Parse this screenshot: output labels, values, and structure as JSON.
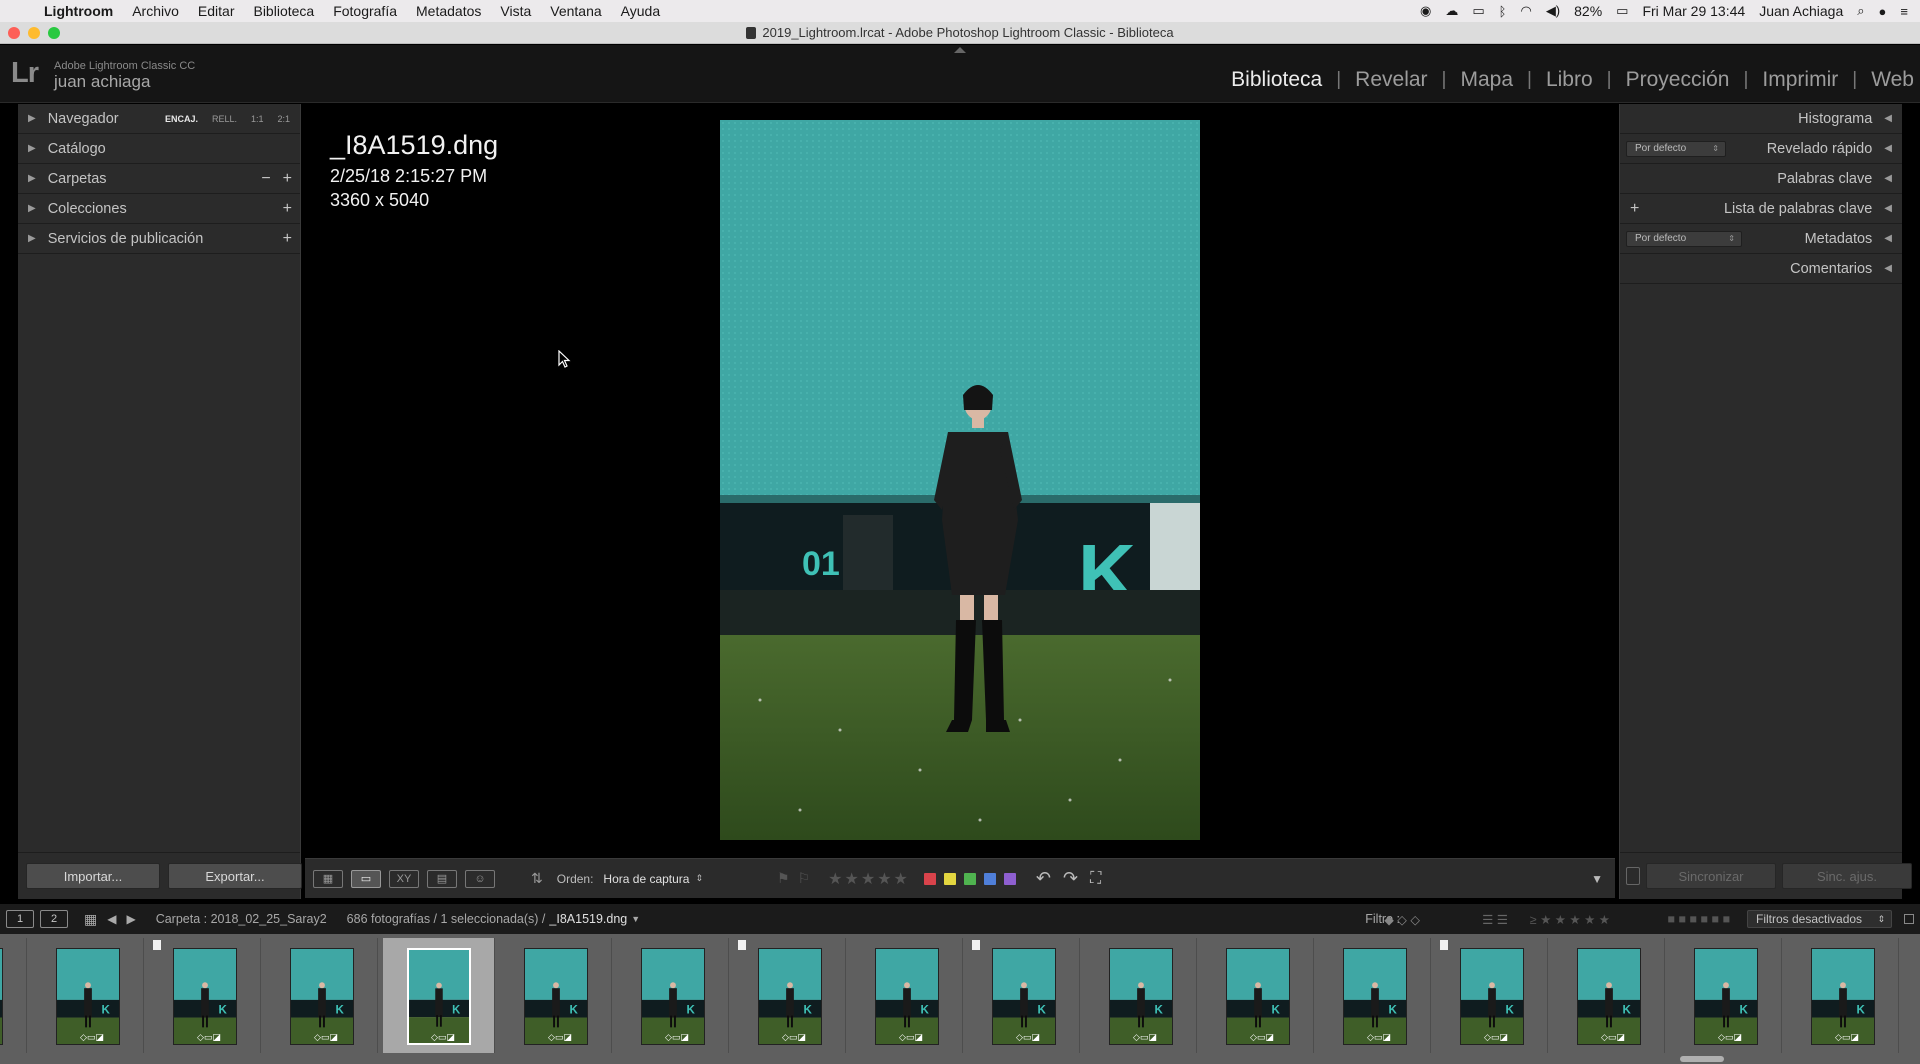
{
  "menubar": {
    "items": [
      "Lightroom",
      "Archivo",
      "Editar",
      "Biblioteca",
      "Fotografía",
      "Metadatos",
      "Vista",
      "Ventana",
      "Ayuda"
    ],
    "battery": "82%",
    "datetime": "Fri Mar 29  13:44",
    "user": "Juan Achiaga"
  },
  "window": {
    "title": "2019_Lightroom.lrcat - Adobe Photoshop Lightroom Classic - Biblioteca"
  },
  "identity": {
    "logo": "Lr",
    "product": "Adobe Lightroom Classic CC",
    "user": "juan achiaga"
  },
  "modules": [
    "Biblioteca",
    "Revelar",
    "Mapa",
    "Libro",
    "Proyección",
    "Imprimir",
    "Web"
  ],
  "left_panel": {
    "navigator": "Navegador",
    "zoom": [
      "ENCAJ.",
      "RELL.",
      "1:1",
      "2:1"
    ],
    "catalog": "Catálogo",
    "folders": "Carpetas",
    "collections": "Colecciones",
    "publish": "Servicios de publicación",
    "import_btn": "Importar...",
    "export_btn": "Exportar..."
  },
  "right_panel": {
    "histogram": "Histograma",
    "quick_develop": "Revelado rápido",
    "quick_develop_preset": "Por defecto",
    "keywording": "Palabras clave",
    "keyword_list": "Lista de palabras clave",
    "metadata": "Metadatos",
    "metadata_preset": "Por defecto",
    "comments": "Comentarios",
    "sync_btn": "Sincronizar",
    "sync_settings_btn": "Sinc. ajus."
  },
  "photo_info": {
    "filename": "_I8A1519.dng",
    "date": "2/25/18 2:15:27 PM",
    "dimensions": "3360 x 5040"
  },
  "toolbar": {
    "sort_label": "Orden:",
    "sort_value": "Hora de captura",
    "color_labels": [
      "#d9434b",
      "#e3d640",
      "#4fb34f",
      "#4f7fd9",
      "#8e5fd0"
    ]
  },
  "filmstrip_header": {
    "monitors": [
      "1",
      "2"
    ],
    "source": "Carpeta : 2018_02_25_Saray2",
    "count": "686 fotografías / 1 seleccionada(s) /",
    "selected_file": "_I8A1519.dng",
    "filter_label": "Filtro :",
    "filter_value": "Filtros desactivados"
  },
  "filmstrip": {
    "selected_index": 4,
    "flagged": [
      0,
      2,
      7,
      9,
      13
    ]
  }
}
